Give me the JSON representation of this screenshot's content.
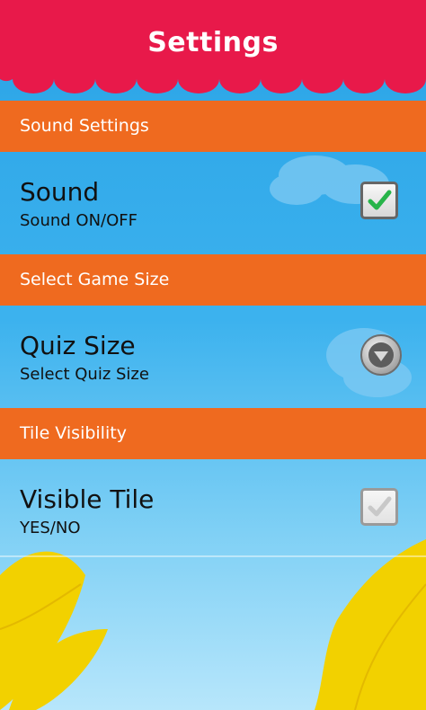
{
  "header": {
    "title": "Settings"
  },
  "sections": [
    {
      "header": "Sound Settings",
      "item": {
        "title": "Sound",
        "subtitle": "Sound ON/OFF",
        "control": "checkbox",
        "checked": true
      }
    },
    {
      "header": "Select Game Size",
      "item": {
        "title": "Quiz Size",
        "subtitle": "Select Quiz Size",
        "control": "dropdown"
      }
    },
    {
      "header": "Tile Visibility",
      "item": {
        "title": "Visible Tile",
        "subtitle": "YES/NO",
        "control": "checkbox",
        "checked": false
      }
    }
  ],
  "colors": {
    "awning": "#e8194a",
    "section": "#ef6a1f",
    "check_on": "#27b44a"
  }
}
